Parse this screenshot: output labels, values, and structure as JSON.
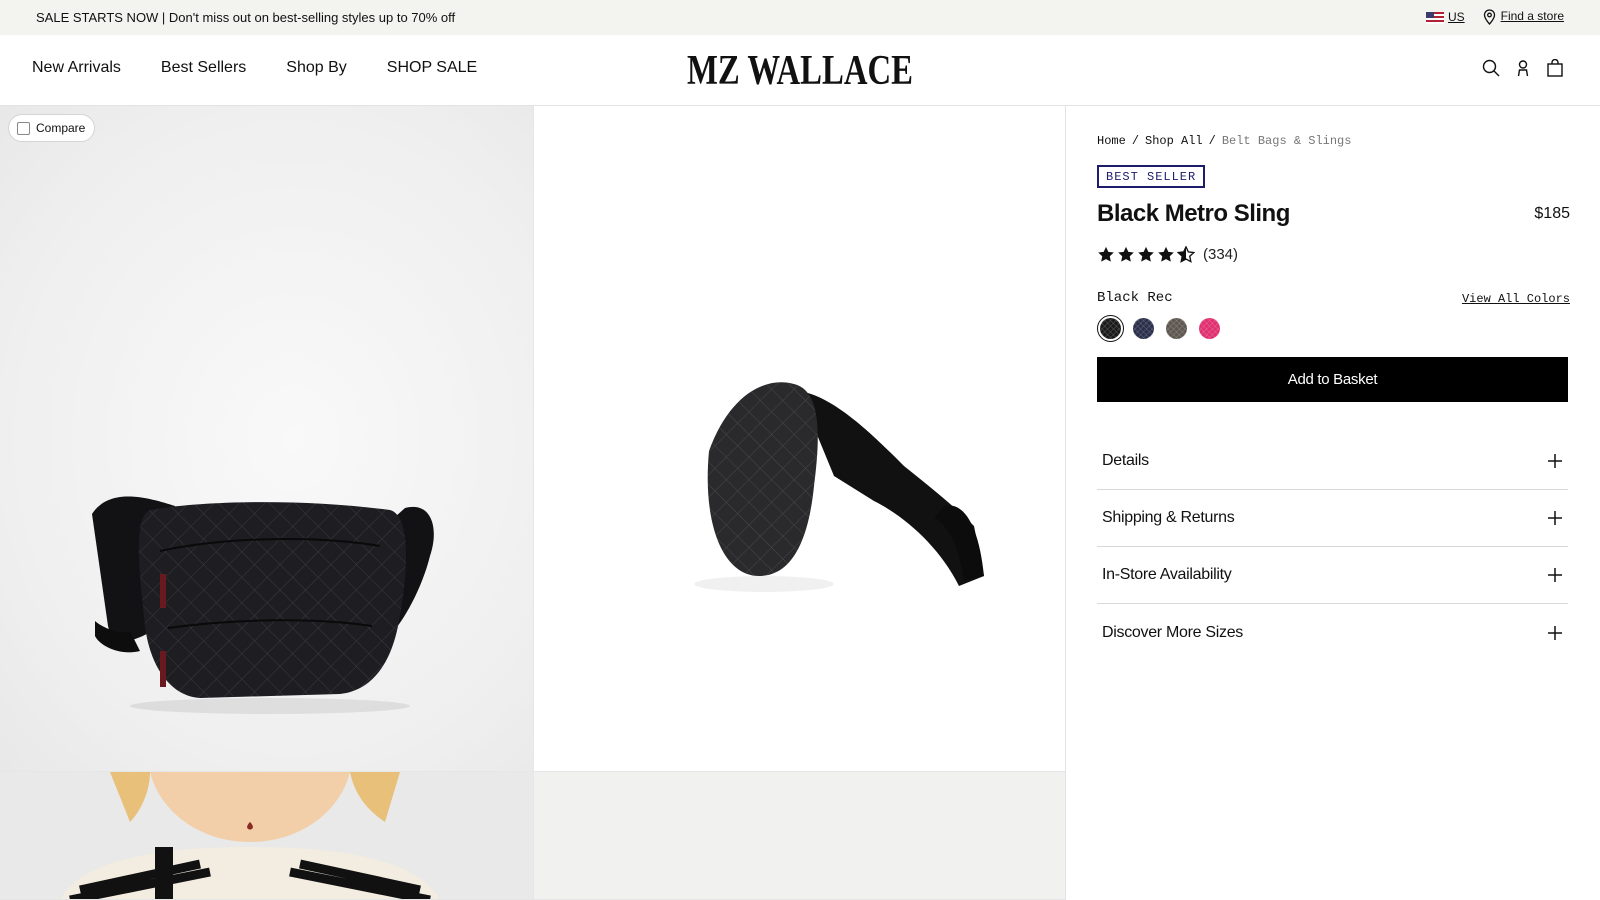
{
  "promo": {
    "text": "SALE STARTS NOW | Don't miss out on best-selling styles up to 70% off",
    "region": "US",
    "find_store": "Find a store"
  },
  "header": {
    "nav": [
      "New Arrivals",
      "Best Sellers",
      "Shop By",
      "SHOP SALE"
    ],
    "logo": "MZ WALLACE",
    "icons": [
      "search-icon",
      "account-icon",
      "basket-icon"
    ]
  },
  "gallery": {
    "compare_label": "Compare"
  },
  "product": {
    "breadcrumbs": [
      "Home",
      "Shop All",
      "Belt Bags & Slings"
    ],
    "badge": "BEST SELLER",
    "title": "Black Metro Sling",
    "price": "$185",
    "rating": 4.5,
    "review_count": "(334)",
    "color_name": "Black Rec",
    "view_all_colors": "View All Colors",
    "swatches": [
      {
        "name": "black",
        "color": "#1a1a1a",
        "selected": true
      },
      {
        "name": "navy",
        "color": "#2a2f4a",
        "selected": false
      },
      {
        "name": "brown",
        "color": "#5e5750",
        "selected": false
      },
      {
        "name": "pink",
        "color": "#e0306f",
        "selected": false
      }
    ],
    "add_to_basket": "Add to Basket",
    "accordion": [
      "Details",
      "Shipping & Returns",
      "In-Store Availability",
      "Discover More Sizes"
    ]
  }
}
